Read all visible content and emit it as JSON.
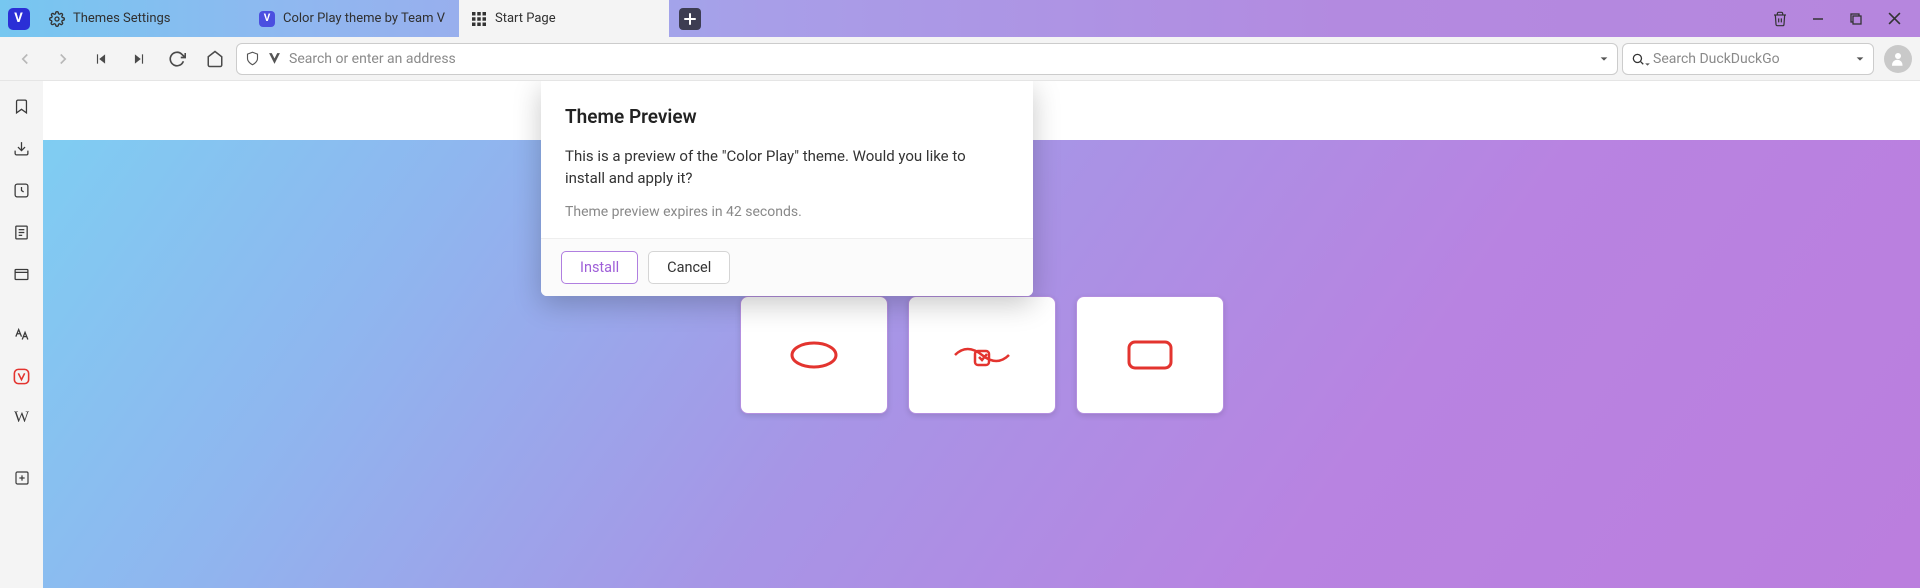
{
  "tabs": [
    {
      "label": "Themes Settings",
      "icon": "gear"
    },
    {
      "label": "Color Play theme by Team V",
      "icon": "vivaldi"
    },
    {
      "label": "Start Page",
      "icon": "apps",
      "active": true
    }
  ],
  "address": {
    "placeholder": "Search or enter an address"
  },
  "search": {
    "placeholder": "Search DuckDuckGo"
  },
  "panels": [
    {
      "name": "bookmarks"
    },
    {
      "name": "downloads"
    },
    {
      "name": "history"
    },
    {
      "name": "notes"
    },
    {
      "name": "window"
    },
    {
      "name": "translate"
    },
    {
      "name": "vivaldi",
      "red": true
    },
    {
      "name": "wikipedia"
    },
    {
      "name": "add"
    }
  ],
  "dialog": {
    "title": "Theme Preview",
    "text": "This is a preview of the \"Color Play\" theme. Would you like to install and apply it?",
    "subtext": "Theme preview expires in 42 seconds.",
    "install": "Install",
    "cancel": "Cancel"
  }
}
